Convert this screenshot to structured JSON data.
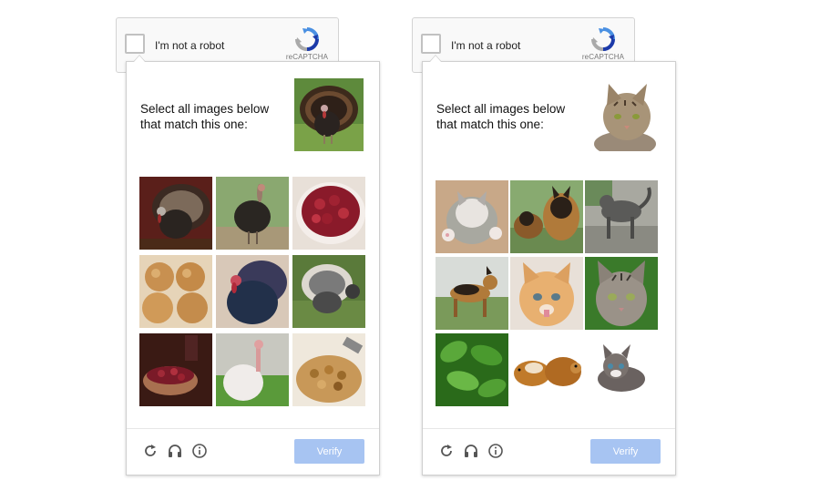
{
  "colors": {
    "accent": "#4a90e2",
    "verify_disabled": "#a7c4f2",
    "recaptcha_blue": "#4285f4",
    "footer_icon": "#555555"
  },
  "widgets": [
    {
      "id": "left",
      "anchor": {
        "label": "I'm not a robot",
        "brand": "reCAPTCHA"
      },
      "challenge": {
        "prompt": "Select all images below that match this one:",
        "target": "turkey",
        "tiles": [
          "turkey-fanned",
          "turkey-dark",
          "cranberries",
          "bread-rolls",
          "turkey-blue",
          "turkey-white-fanned",
          "cranberry-dish",
          "turkey-white",
          "stuffing"
        ],
        "verify_label": "Verify"
      }
    },
    {
      "id": "right",
      "anchor": {
        "label": "I'm not a robot",
        "brand": "reCAPTCHA"
      },
      "challenge": {
        "prompt": "Select all images below that match this one:",
        "target": "tabby-cat",
        "tiles": [
          "kitten-on-back",
          "german-shepherds",
          "cat-on-rocks",
          "german-shepherd-standing",
          "orange-kitten",
          "tabby-kitten",
          "green-leaves",
          "guinea-pigs",
          "kitten-crouching"
        ],
        "verify_label": "Verify"
      }
    }
  ]
}
